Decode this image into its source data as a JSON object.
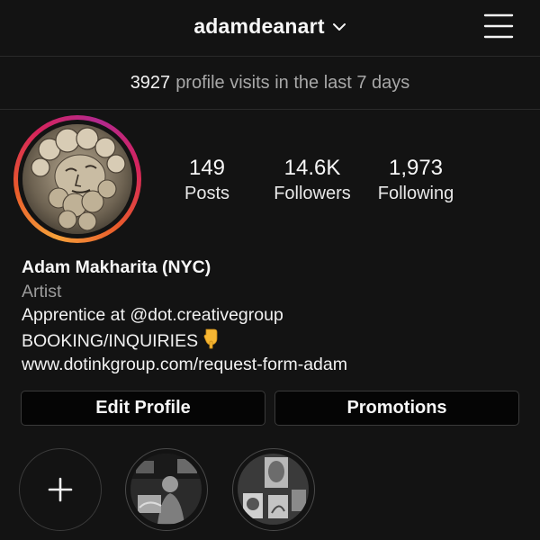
{
  "header": {
    "username": "adamdeanart",
    "chevron_icon": "chevron-down-icon",
    "menu_icon": "hamburger-menu-icon"
  },
  "insights": {
    "visits_count": "3927",
    "visits_text": "profile visits in the last 7 days"
  },
  "profile": {
    "avatar_icon": "profile-photo-statue",
    "stats": [
      {
        "value": "149",
        "label": "Posts"
      },
      {
        "value": "14.6K",
        "label": "Followers"
      },
      {
        "value": "1,973",
        "label": "Following"
      }
    ],
    "name": "Adam Makharita (NYC)",
    "category": "Artist",
    "bio_line1": "Apprentice at @dot.creativegroup",
    "bio_line2": "BOOKING/INQUIRIES",
    "bio_emoji": "pointing-down-emoji",
    "link": "www.dotinkgroup.com/request-form-adam"
  },
  "actions": {
    "edit_profile": "Edit Profile",
    "promotions": "Promotions"
  },
  "highlights": {
    "new_icon": "plus-icon",
    "items": [
      "highlight-1",
      "highlight-2"
    ]
  },
  "colors": {
    "background": "#131313",
    "text_primary": "#f7f7f7",
    "text_secondary": "#a8a8a8",
    "ring_gradient": [
      "#f6a13a",
      "#d6245c",
      "#b2298f"
    ]
  }
}
